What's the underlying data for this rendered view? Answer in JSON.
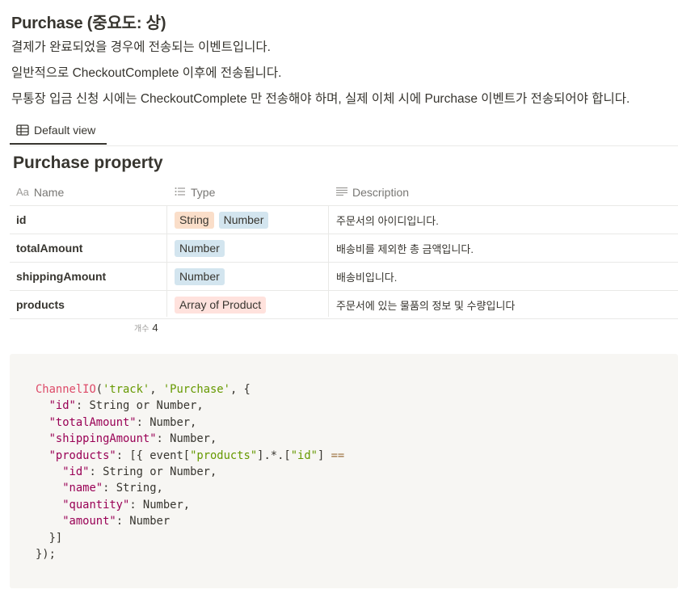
{
  "heading": "Purchase (중요도: 상)",
  "paragraphs": [
    "결제가 완료되었을 경우에 전송되는 이벤트입니다.",
    "일반적으로 CheckoutComplete 이후에 전송됩니다.",
    "무통장 입금 신청 시에는 CheckoutComplete 만 전송해야 하며, 실제 이체 시에 Purchase 이벤트가 전송되어야 합니다."
  ],
  "view_tab": {
    "label": "Default view",
    "icon": "table-icon"
  },
  "database": {
    "title": "Purchase property",
    "columns": [
      {
        "label": "Name",
        "icon": "text-aa-icon"
      },
      {
        "label": "Type",
        "icon": "list-icon"
      },
      {
        "label": "Description",
        "icon": "text-lines-icon"
      }
    ],
    "rows": [
      {
        "name": "id",
        "types": [
          "String",
          "Number"
        ],
        "type_colors": [
          "orange",
          "blue"
        ],
        "description": "주문서의 아이디입니다."
      },
      {
        "name": "totalAmount",
        "types": [
          "Number"
        ],
        "type_colors": [
          "blue"
        ],
        "description": "배송비를 제외한 총 금액입니다."
      },
      {
        "name": "shippingAmount",
        "types": [
          "Number"
        ],
        "type_colors": [
          "blue"
        ],
        "description": "배송비입니다."
      },
      {
        "name": "products",
        "types": [
          "Array of Product"
        ],
        "type_colors": [
          "red"
        ],
        "description": "주문서에 있는 물품의 정보 및 수량입니다"
      }
    ],
    "count_label": "개수",
    "count_value": "4"
  },
  "code_lines": [
    "ChannelIO('track', 'Purchase', {",
    "  \"id\": String or Number,",
    "  \"totalAmount\": Number,",
    "  \"shippingAmount\": Number,",
    "  \"products\": [{ event[\"products\"].*.[\"id\"] ==",
    "    \"id\": String or Number,",
    "    \"name\": String,",
    "    \"quantity\": Number,",
    "    \"amount\": Number",
    "  }]",
    "});"
  ],
  "colors": {
    "tag_orange": "#fadec9",
    "tag_blue": "#d3e5ef",
    "tag_red": "#ffe2dd",
    "code_bg": "#f7f6f3"
  }
}
